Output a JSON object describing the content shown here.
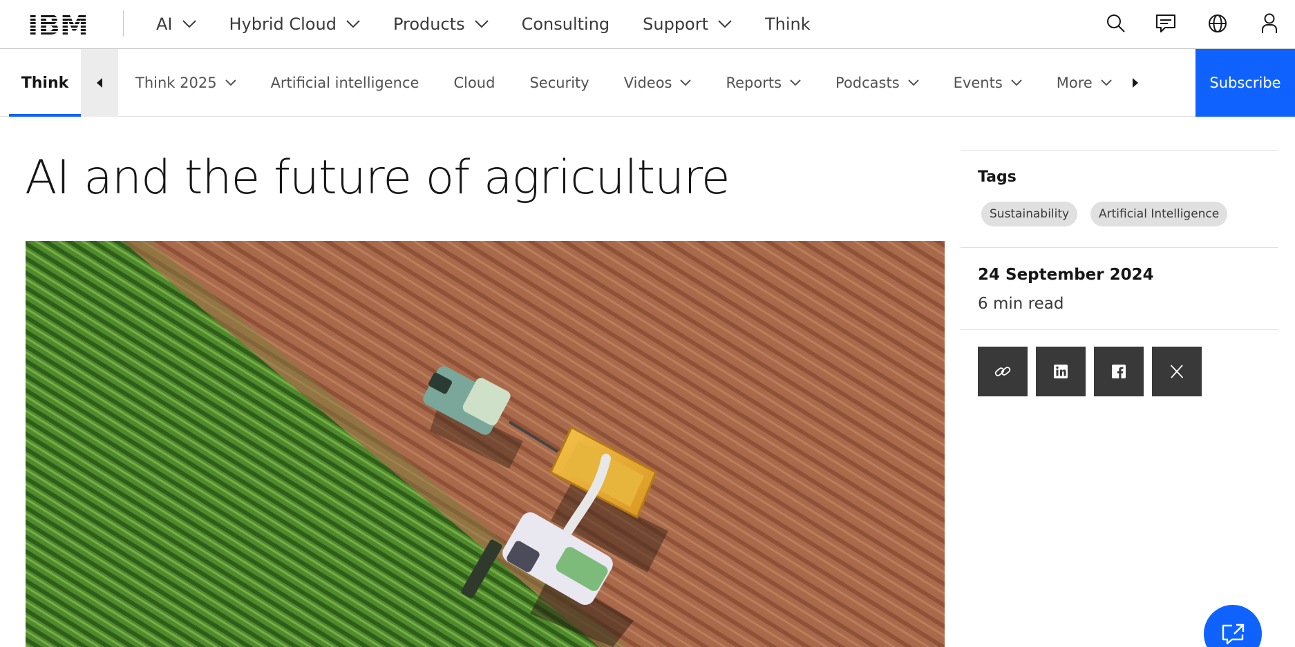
{
  "brand": {
    "logo_text": "IBM"
  },
  "topnav": {
    "items": [
      {
        "label": "AI",
        "dropdown": true
      },
      {
        "label": "Hybrid Cloud",
        "dropdown": true
      },
      {
        "label": "Products",
        "dropdown": true
      },
      {
        "label": "Consulting",
        "dropdown": false
      },
      {
        "label": "Support",
        "dropdown": true
      },
      {
        "label": "Think",
        "dropdown": false
      }
    ],
    "utilities": [
      "search-icon",
      "chat-icon",
      "globe-icon",
      "user-icon"
    ]
  },
  "subnav": {
    "home": "Think",
    "items": [
      {
        "label": "Think 2025",
        "dropdown": true
      },
      {
        "label": "Artificial intelligence",
        "dropdown": false
      },
      {
        "label": "Cloud",
        "dropdown": false
      },
      {
        "label": "Security",
        "dropdown": false
      },
      {
        "label": "Videos",
        "dropdown": true
      },
      {
        "label": "Reports",
        "dropdown": true
      },
      {
        "label": "Podcasts",
        "dropdown": true
      },
      {
        "label": "Events",
        "dropdown": true
      },
      {
        "label": "More",
        "dropdown": true
      }
    ],
    "subscribe": "Subscribe"
  },
  "article": {
    "title": "AI and the future of agriculture",
    "hero_image": "aerial-corn-harvest"
  },
  "sidebar": {
    "tags_heading": "Tags",
    "tags": [
      "Sustainability",
      "Artificial Intelligence"
    ],
    "date": "24 September 2024",
    "read_time": "6 min read",
    "share": [
      "link-icon",
      "linkedin-icon",
      "facebook-icon",
      "x-icon"
    ]
  },
  "colors": {
    "accent": "#0f62fe",
    "text": "#161616",
    "tag_bg": "#e0e0e0",
    "share_bg": "#393939"
  }
}
